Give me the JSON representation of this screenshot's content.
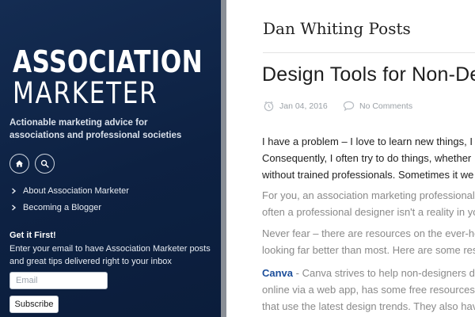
{
  "sidebar": {
    "logo_line1": "ASSOCIATION",
    "logo_line2": "MARKETER",
    "tagline": "Actionable marketing advice for associations and professional societies",
    "icons": [
      "home-icon",
      "search-icon"
    ],
    "nav": [
      {
        "label": "About Association Marketer"
      },
      {
        "label": "Becoming a Blogger"
      }
    ],
    "signup": {
      "title": "Get it First!",
      "text": "Enter your email to have Association Marketer posts and great tips delivered right to your inbox",
      "email_placeholder": "Email",
      "button_label": "Subscribe"
    },
    "colors": {
      "background": "#0f2547",
      "divider": "#8a8f96"
    }
  },
  "main": {
    "section_heading": "Dan Whiting Posts",
    "post": {
      "title": "Design Tools for Non-Desig",
      "date": "Jan 04, 2016",
      "comments": "No Comments",
      "paragraphs": {
        "p1": [
          "I have a problem – I love to learn new things, I c",
          "Consequently, I often try to do things, whether",
          "without trained professionals. Sometimes it we"
        ],
        "p2": [
          "For you, an association marketing professional, ",
          "often a professional designer isn't a reality in yo"
        ],
        "p3": [
          "Never fear – there are resources on the ever-he",
          "looking far better than most. Here are some res"
        ],
        "p4": {
          "link": "Canva",
          "line1_rest": " - Canva strives to help non-designers de",
          "line2": "online via a web app, has some free resources ar",
          "line3": "that use the latest design trends. They also have"
        }
      }
    },
    "colors": {
      "link": "#1d4f9b",
      "meta": "#9aa0a6"
    }
  }
}
